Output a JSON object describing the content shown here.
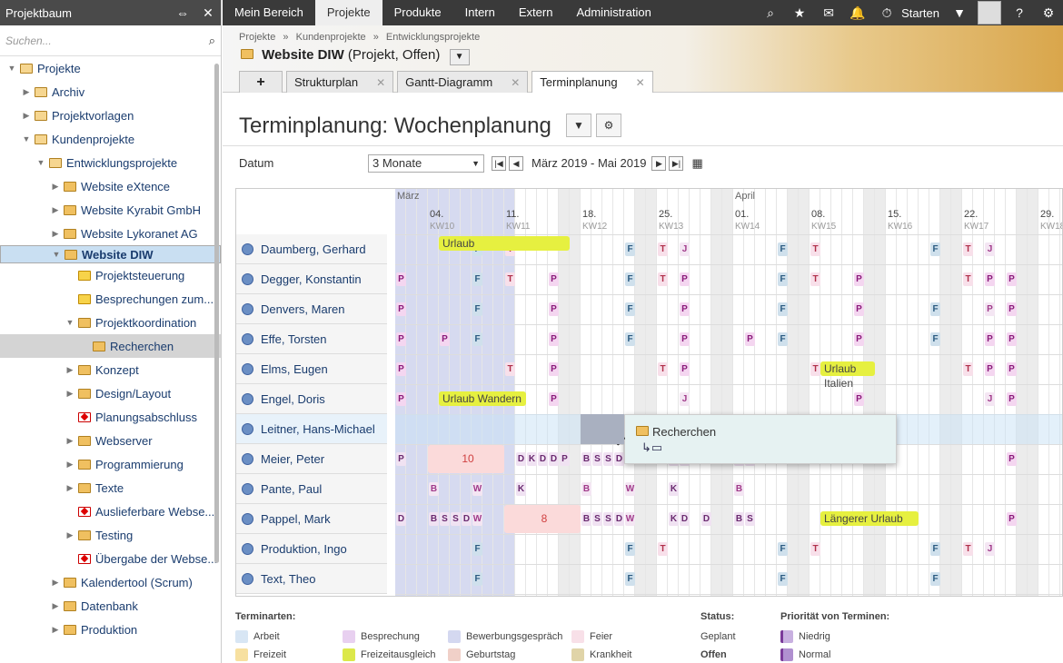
{
  "sidebar": {
    "title": "Projektbaum",
    "search_placeholder": "Suchen...",
    "items": [
      {
        "label": "Projekte",
        "level": 0,
        "tw": "▼",
        "icon": "project-folder-icon"
      },
      {
        "label": "Archiv",
        "level": 1,
        "tw": "▶",
        "icon": "project-folder-icon"
      },
      {
        "label": "Projektvorlagen",
        "level": 1,
        "tw": "▶",
        "icon": "project-folder-icon"
      },
      {
        "label": "Kundenprojekte",
        "level": 1,
        "tw": "▼",
        "icon": "project-folder-icon"
      },
      {
        "label": "Entwicklungsprojekte",
        "level": 2,
        "tw": "▼",
        "icon": "project-folder-icon"
      },
      {
        "label": "Website eXtence",
        "level": 3,
        "tw": "▶",
        "icon": "folder-icon"
      },
      {
        "label": "Website Kyrabit GmbH",
        "level": 3,
        "tw": "▶",
        "icon": "folder-icon"
      },
      {
        "label": "Website Lykoranet AG",
        "level": 3,
        "tw": "▶",
        "icon": "folder-icon"
      },
      {
        "label": "Website DIW",
        "level": 3,
        "tw": "▼",
        "icon": "folder-icon",
        "sel": true
      },
      {
        "label": "Projektsteuerung",
        "level": 4,
        "tw": "",
        "icon": "task-icon"
      },
      {
        "label": "Besprechungen zum...",
        "level": 4,
        "tw": "",
        "icon": "task-icon"
      },
      {
        "label": "Projektkoordination",
        "level": 4,
        "tw": "▼",
        "icon": "folder-icon"
      },
      {
        "label": "Recherchen",
        "level": 5,
        "tw": "",
        "icon": "folder-icon",
        "sel2": true
      },
      {
        "label": "Konzept",
        "level": 4,
        "tw": "▶",
        "icon": "folder-icon"
      },
      {
        "label": "Design/Layout",
        "level": 4,
        "tw": "▶",
        "icon": "folder-icon"
      },
      {
        "label": "Planungsabschluss",
        "level": 4,
        "tw": "",
        "icon": "milestone-icon"
      },
      {
        "label": "Webserver",
        "level": 4,
        "tw": "▶",
        "icon": "folder-icon"
      },
      {
        "label": "Programmierung",
        "level": 4,
        "tw": "▶",
        "icon": "folder-icon"
      },
      {
        "label": "Texte",
        "level": 4,
        "tw": "▶",
        "icon": "folder-icon"
      },
      {
        "label": "Auslieferbare Webse...",
        "level": 4,
        "tw": "",
        "icon": "milestone-icon"
      },
      {
        "label": "Testing",
        "level": 4,
        "tw": "▶",
        "icon": "folder-icon"
      },
      {
        "label": "Übergabe der Webse...",
        "level": 4,
        "tw": "",
        "icon": "milestone-icon"
      },
      {
        "label": "Kalendertool (Scrum)",
        "level": 3,
        "tw": "▶",
        "icon": "folder-icon"
      },
      {
        "label": "Datenbank",
        "level": 3,
        "tw": "▶",
        "icon": "folder-icon"
      },
      {
        "label": "Produktion",
        "level": 3,
        "tw": "▶",
        "icon": "folder-icon"
      }
    ]
  },
  "nav": {
    "items": [
      "Mein Bereich",
      "Projekte",
      "Produkte",
      "Intern",
      "Extern",
      "Administration"
    ],
    "active": 1,
    "start_label": "Starten"
  },
  "header": {
    "breadcrumb": [
      "Projekte",
      "»",
      "Kundenprojekte",
      "»",
      "Entwicklungsprojekte"
    ],
    "title": "Website DIW",
    "subtitle": "(Projekt, Offen)",
    "tabs": [
      {
        "label": "Strukturplan"
      },
      {
        "label": "Gantt-Diagramm"
      },
      {
        "label": "Terminplanung"
      }
    ]
  },
  "page": {
    "title": "Terminplanung: Wochenplanung",
    "date_label": "Datum",
    "range_select": "3 Monate",
    "range_text": "März 2019 - Mai 2019"
  },
  "calendar": {
    "months": [
      {
        "label": "März",
        "col": 0
      },
      {
        "label": "April",
        "col": 31
      }
    ],
    "weeks": [
      {
        "day": "04.",
        "kw": "KW10",
        "col": 3
      },
      {
        "day": "11.",
        "kw": "KW11",
        "col": 10
      },
      {
        "day": "18.",
        "kw": "KW12",
        "col": 17
      },
      {
        "day": "25.",
        "kw": "KW13",
        "col": 24
      },
      {
        "day": "01.",
        "kw": "KW14",
        "col": 31
      },
      {
        "day": "08.",
        "kw": "KW15",
        "col": 38
      },
      {
        "day": "15.",
        "kw": "KW16",
        "col": 45
      },
      {
        "day": "22.",
        "kw": "KW17",
        "col": 52
      },
      {
        "day": "29.",
        "kw": "KW18",
        "col": 59
      }
    ],
    "persons": [
      "Daumberg, Gerhard",
      "Degger, Konstantin",
      "Denvers, Maren",
      "Effe, Torsten",
      "Elms, Eugen",
      "Engel, Doris",
      "Leitner, Hans-Michael",
      "Meier, Peter",
      "Pante, Paul",
      "Pappel, Mark",
      "Produktion, Ingo",
      "Text, Theo"
    ],
    "bars": [
      {
        "row": 0,
        "col": 4,
        "span": 12,
        "label": "Urlaub",
        "kind": "yel"
      },
      {
        "row": 4,
        "col": 39,
        "span": 5,
        "label": "Urlaub Italien",
        "kind": "yel"
      },
      {
        "row": 5,
        "col": 4,
        "span": 8,
        "label": "Urlaub Wandern",
        "kind": "yel"
      },
      {
        "row": 7,
        "col": 3,
        "span": 7,
        "label": "10",
        "kind": "red"
      },
      {
        "row": 9,
        "col": 10,
        "span": 7,
        "label": "8",
        "kind": "red"
      },
      {
        "row": 9,
        "col": 39,
        "span": 9,
        "label": "Längerer Urlaub",
        "kind": "yel"
      }
    ],
    "popup": {
      "label": "Recherchen"
    }
  },
  "legend": {
    "types_title": "Terminarten:",
    "types": [
      {
        "label": "Arbeit",
        "color": "#d8e6f4"
      },
      {
        "label": "Besprechung",
        "color": "#e8d0f0"
      },
      {
        "label": "Bewerbungsgespräch",
        "color": "#d4d8f0"
      },
      {
        "label": "Feier",
        "color": "#f8e0e8"
      },
      {
        "label": "Freizeit",
        "color": "#f7e0a0"
      },
      {
        "label": "Freizeitausgleich",
        "color": "#dce84a"
      },
      {
        "label": "Geburtstag",
        "color": "#f0d0c8"
      },
      {
        "label": "Krankheit",
        "color": "#e0d4a8"
      }
    ],
    "status_title": "Status:",
    "status": [
      "Geplant",
      "Offen"
    ],
    "prio_title": "Priorität von Terminen:",
    "prio": [
      "Niedrig",
      "Normal"
    ]
  },
  "colors": {
    "nav_bg": "#3a3a3a",
    "selected": "#c9dff2",
    "vacation": "#e6f040"
  }
}
